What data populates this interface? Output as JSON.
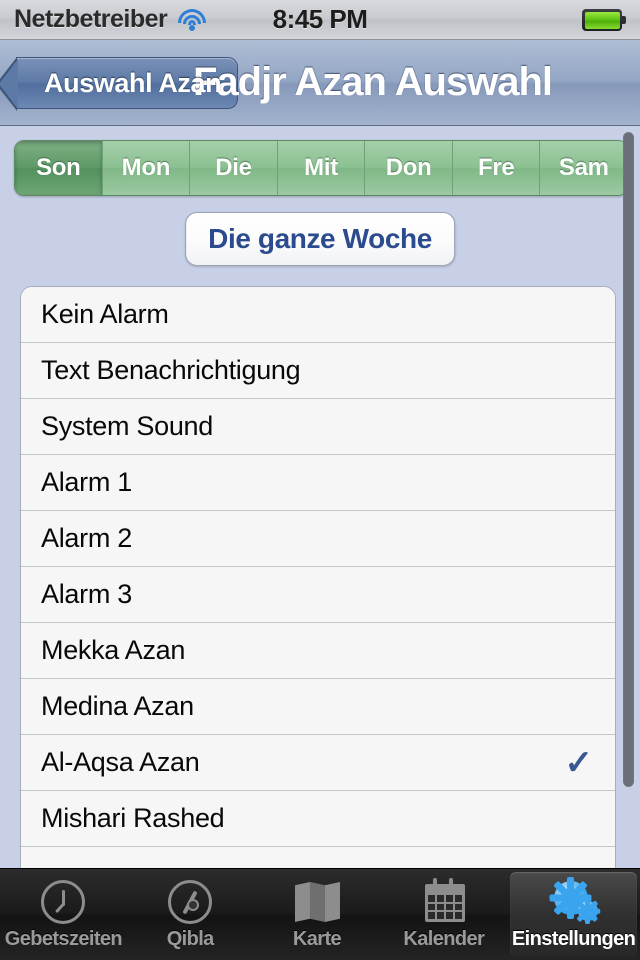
{
  "statusbar": {
    "carrier": "Netzbetreiber",
    "wifi_icon": "wifi-icon",
    "time": "8:45 PM",
    "battery_icon": "battery-icon"
  },
  "navbar": {
    "back_label": "Auswahl Azan",
    "title": "Fadjr Azan Auswahl"
  },
  "segmented": {
    "items": [
      {
        "label": "Son",
        "selected": true
      },
      {
        "label": "Mon",
        "selected": false
      },
      {
        "label": "Die",
        "selected": false
      },
      {
        "label": "Mit",
        "selected": false
      },
      {
        "label": "Don",
        "selected": false
      },
      {
        "label": "Fre",
        "selected": false
      },
      {
        "label": "Sam",
        "selected": false
      }
    ]
  },
  "week_button": {
    "label": "Die ganze Woche"
  },
  "list": {
    "rows": [
      {
        "label": "Kein Alarm",
        "checked": false
      },
      {
        "label": "Text Benachrichtigung",
        "checked": false
      },
      {
        "label": "System Sound",
        "checked": false
      },
      {
        "label": "Alarm 1",
        "checked": false
      },
      {
        "label": "Alarm 2",
        "checked": false
      },
      {
        "label": "Alarm 3",
        "checked": false
      },
      {
        "label": "Mekka Azan",
        "checked": false
      },
      {
        "label": "Medina Azan",
        "checked": false
      },
      {
        "label": "Al-Aqsa Azan",
        "checked": true
      },
      {
        "label": "Mishari Rashed",
        "checked": false
      },
      {
        "label": "",
        "checked": false
      }
    ],
    "check_glyph": "✓",
    "check_color": "#3b5892"
  },
  "tabbar": {
    "tabs": [
      {
        "label": "Gebetszeiten",
        "icon": "clock-icon",
        "selected": false
      },
      {
        "label": "Qibla",
        "icon": "compass-icon",
        "selected": false
      },
      {
        "label": "Karte",
        "icon": "map-icon",
        "selected": false
      },
      {
        "label": "Kalender",
        "icon": "calendar-icon",
        "selected": false
      },
      {
        "label": "Einstellungen",
        "icon": "gear-icon",
        "selected": true
      }
    ]
  },
  "colors": {
    "background": "#c7d0e6",
    "accent_blue": "#3b5892",
    "segment_green": "#8cc192",
    "segment_green_selected": "#5f9a68",
    "tab_selected_blue": "#3aa5ee"
  }
}
